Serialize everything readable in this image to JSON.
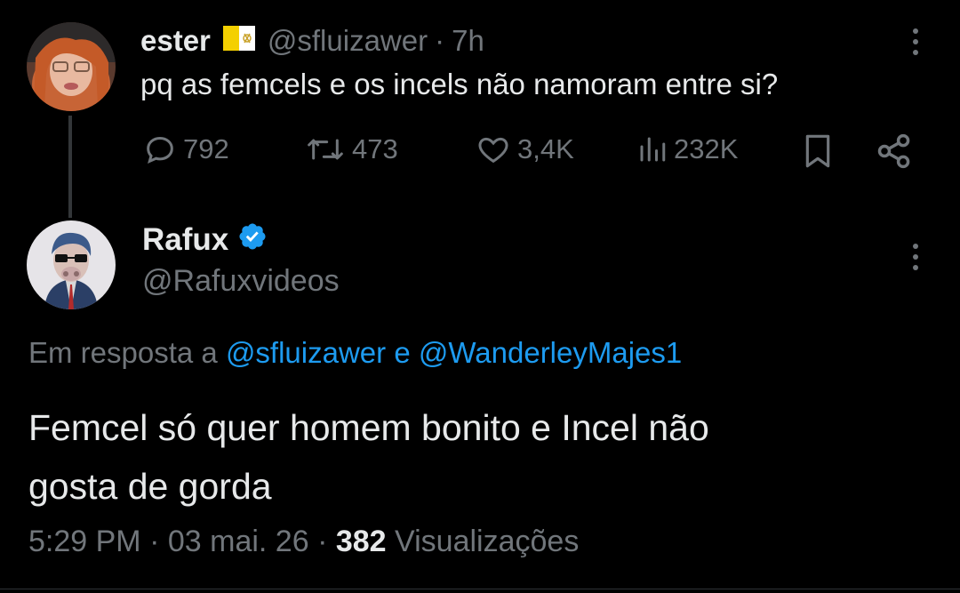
{
  "original_tweet": {
    "display_name": "ester",
    "flag_emoji": "🇻🇦",
    "handle": "@sfluizawer",
    "separator": "·",
    "time": "7h",
    "text": "pq as femcels e os incels não namoram entre si?",
    "actions": {
      "replies": "792",
      "retweets": "473",
      "likes": "3,4K",
      "views": "232K"
    }
  },
  "reply": {
    "display_name": "Rafux",
    "handle": "@Rafuxvideos",
    "replying_to_prefix": "Em resposta a",
    "replying_to_user1": "@sfluizawer",
    "replying_to_and": "e",
    "replying_to_user2": "@WanderleyMajes1",
    "text_line1": "Femcel só quer homem bonito e Incel não",
    "text_line2": "gosta de gorda",
    "time": "5:29 PM",
    "sep1": "·",
    "date": "03 mai. 26",
    "sep2": "·",
    "views_count": "382",
    "views_label": "Visualizações"
  },
  "colors": {
    "background": "#000000",
    "text_primary": "#e7e9ea",
    "text_muted": "#71767b",
    "link": "#1d9bf0",
    "verified": "#1d9bf0"
  }
}
